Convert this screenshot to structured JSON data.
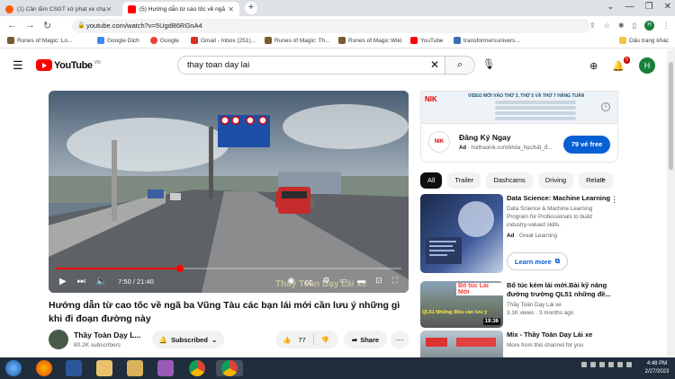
{
  "browser": {
    "tabs": [
      {
        "title": "(1) Cần lắm CSGT xử phạt xe chạ",
        "active": false
      },
      {
        "title": "(5) Hướng dẫn từ cao tốc về ngã",
        "active": true
      }
    ],
    "url": "youtube.com/watch?v=5UgdB6RGnA4",
    "profile_initial": "H",
    "bookmarks": [
      "Runes of Magic: Lo...",
      "Google Dịch",
      "Google",
      "Gmail - Inbox (251)...",
      "Runes of Magic: Th...",
      "Runes of Magic Wiki",
      "YouTube",
      "transformersunivers...",
      "Dấu trang khác"
    ]
  },
  "youtube": {
    "logo_text": "YouTube",
    "country_code": "VN",
    "search_query": "thay toan day lai",
    "notification_count": "5",
    "avatar_initial": "H"
  },
  "video": {
    "time_display": "7:50 / 21:40",
    "progress_fraction": 0.36,
    "watermark": "Thầy Toàn Dạy Lái xe",
    "title": "Hướng dẫn từ cao tốc về ngã ba Vũng Tàu các bạn lái mới cần lưu ý những gì khi đi đoạn đường này",
    "channel": "Thầy Toàn Dạy L...",
    "subscribers": "80.2K subscribers",
    "subscribed_label": "Subscribed",
    "likes": "77",
    "share_label": "Share"
  },
  "sidebar": {
    "ad": {
      "banner_headline": "VIDEO MỚI VÀO THỨ 3, THỨ 5 VÀ THỨ 7 HÀNG TUẦN",
      "logo": "NIK",
      "title": "Đăng Ký Ngay",
      "ad_label": "Ad",
      "domain": "hoithaonik.com/khóa_học/bất_đ...",
      "cta": "79 vé free"
    },
    "chips": [
      "All",
      "Trailer",
      "Dashcams",
      "Driving",
      "Relate"
    ],
    "recs": [
      {
        "title": "Data Science: Machine Learning",
        "desc": "Data Science & Machine Learning Program for Professionals to build industry-valued skills.",
        "ad_label": "Ad",
        "meta": "· Great Learning",
        "cta": "Learn more"
      },
      {
        "title": "Bổ túc kèm lái mới.Bài kỹ năng đường trường QL51 những đề...",
        "channel": "Thầy Toàn Dạy Lái xe",
        "meta": "3.1K views · 3 months ago",
        "duration": "19:36",
        "thumb_text": "Bổ túc Lái Mới",
        "thumb_sub": "QL51 Những điều cần lưu ý"
      },
      {
        "title": "Mix - Thầy Toàn Dạy Lái xe",
        "channel": "More from this channel for you"
      }
    ]
  },
  "taskbar": {
    "time": "4:48 PM",
    "date": "2/27/2023"
  }
}
